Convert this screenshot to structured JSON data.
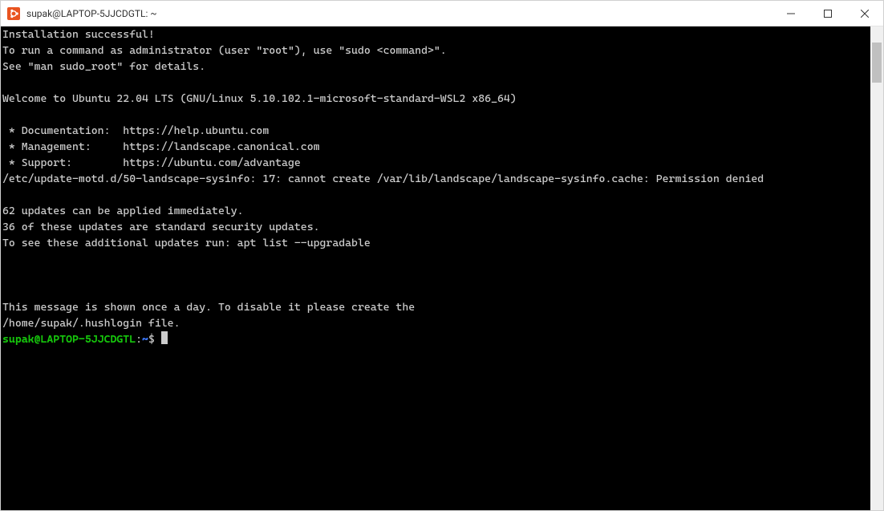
{
  "window": {
    "title": "supak@LAPTOP-5JJCDGTL: ~"
  },
  "terminal": {
    "lines": [
      "Installation successful!",
      "To run a command as administrator (user \"root\"), use \"sudo <command>\".",
      "See \"man sudo_root\" for details.",
      "",
      "Welcome to Ubuntu 22.04 LTS (GNU/Linux 5.10.102.1-microsoft-standard-WSL2 x86_64)",
      "",
      " * Documentation:  https://help.ubuntu.com",
      " * Management:     https://landscape.canonical.com",
      " * Support:        https://ubuntu.com/advantage",
      "/etc/update-motd.d/50-landscape-sysinfo: 17: cannot create /var/lib/landscape/landscape-sysinfo.cache: Permission denied",
      "",
      "62 updates can be applied immediately.",
      "36 of these updates are standard security updates.",
      "To see these additional updates run: apt list --upgradable",
      "",
      "",
      "",
      "This message is shown once a day. To disable it please create the",
      "/home/supak/.hushlogin file."
    ],
    "prompt": {
      "userhost": "supak@LAPTOP-5JJCDGTL",
      "colon": ":",
      "path": "~",
      "symbol": "$ "
    }
  }
}
